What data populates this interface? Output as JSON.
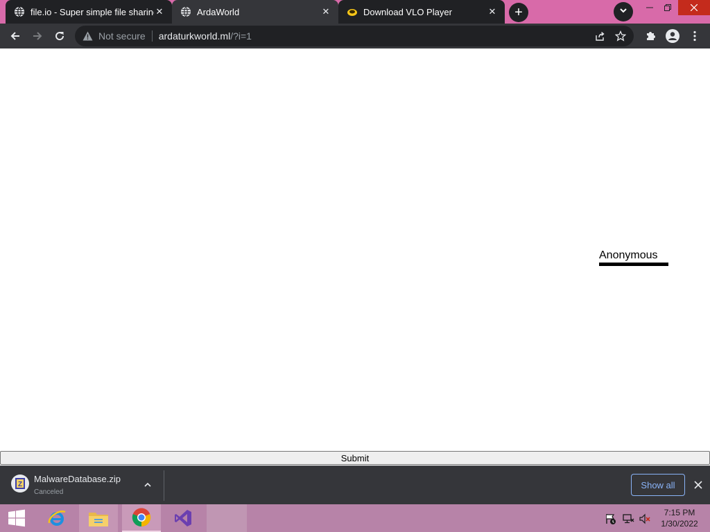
{
  "browser": {
    "tabs": [
      {
        "title": "file.io - Super simple file sharing",
        "favicon": "globe-icon",
        "state": "inactive"
      },
      {
        "title": "ArdaWorld",
        "favicon": "globe-icon",
        "state": "active"
      },
      {
        "title": "Download VLO Player",
        "favicon": "vlo-favicon",
        "state": "inactive"
      }
    ],
    "new_tab_label": "+",
    "address_bar": {
      "security_label": "Not secure",
      "host": "ardaturkworld.ml",
      "path": "/?i=1"
    }
  },
  "page": {
    "anonymous_label": "Anonymous",
    "submit_label": "Submit"
  },
  "download_shelf": {
    "filename": "MalwareDatabase.zip",
    "status": "Canceled",
    "show_all_label": "Show all"
  },
  "taskbar": {
    "time": "7:15 PM",
    "date": "1/30/2022",
    "apps": [
      "internet-explorer-icon",
      "file-explorer-icon",
      "chrome-icon",
      "visual-studio-icon"
    ]
  },
  "colors": {
    "titlebar": "#d86aa9",
    "taskbar": "#b783a8",
    "chrome_dark": "#35363a",
    "accent_blue": "#8ab4f8"
  }
}
